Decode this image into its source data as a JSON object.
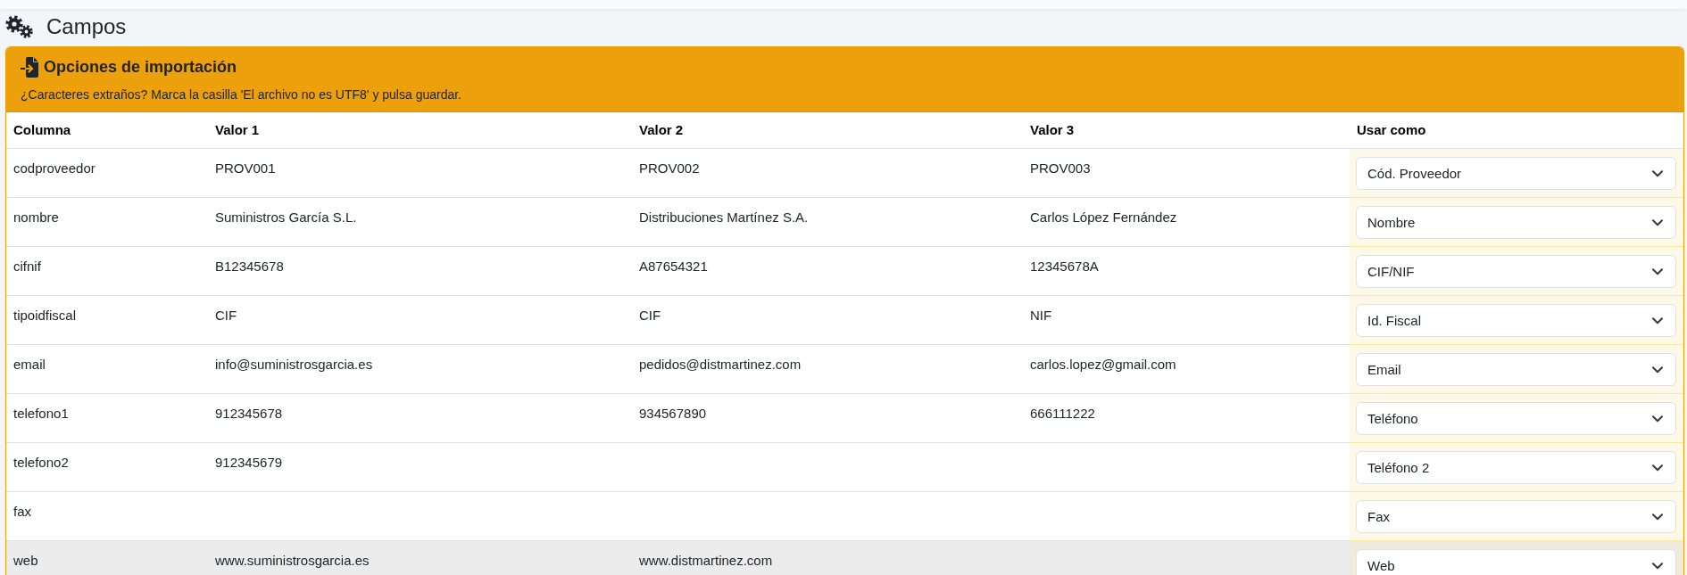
{
  "page": {
    "title": "Campos"
  },
  "import_options": {
    "title": "Opciones de importación",
    "message": "¿Caracteres extraños? Marca la casilla 'El archivo no es UTF8' y pulsa guardar."
  },
  "table": {
    "columns": [
      "Columna",
      "Valor 1",
      "Valor 2",
      "Valor 3",
      "Usar como"
    ],
    "rows": [
      {
        "column": "codproveedor",
        "values": [
          "PROV001",
          "PROV002",
          "PROV003"
        ],
        "use_as": "Cód. Proveedor",
        "hovered": false
      },
      {
        "column": "nombre",
        "values": [
          "Suministros García S.L.",
          "Distribuciones Martínez S.A.",
          "Carlos López Fernández"
        ],
        "use_as": "Nombre",
        "hovered": false
      },
      {
        "column": "cifnif",
        "values": [
          "B12345678",
          "A87654321",
          "12345678A"
        ],
        "use_as": "CIF/NIF",
        "hovered": false
      },
      {
        "column": "tipoidfiscal",
        "values": [
          "CIF",
          "CIF",
          "NIF"
        ],
        "use_as": "Id. Fiscal",
        "hovered": false
      },
      {
        "column": "email",
        "values": [
          "info@suministrosgarcia.es",
          "pedidos@distmartinez.com",
          "carlos.lopez@gmail.com"
        ],
        "use_as": "Email",
        "hovered": false
      },
      {
        "column": "telefono1",
        "values": [
          "912345678",
          "934567890",
          "666111222"
        ],
        "use_as": "Teléfono",
        "hovered": false
      },
      {
        "column": "telefono2",
        "values": [
          "912345679"
        ],
        "use_as": "Teléfono 2",
        "hovered": false
      },
      {
        "column": "fax",
        "use_as": "Fax",
        "hovered": false
      },
      {
        "column": "web",
        "values": [
          "www.suministrosgarcia.es",
          "www.distmartinez.com"
        ],
        "use_as": "Web",
        "hovered": true
      }
    ]
  }
}
